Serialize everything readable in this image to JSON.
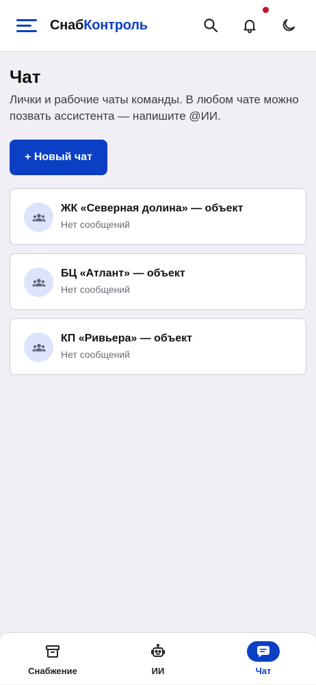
{
  "header": {
    "brand_part1": "Снаб",
    "brand_part2": "Контроль",
    "has_notification": true,
    "accent_color": "#0b3fc4",
    "notification_color": "#c8102e",
    "icons": [
      "menu-icon",
      "search-icon",
      "bell-icon",
      "moon-icon"
    ]
  },
  "page": {
    "title": "Чат",
    "subtitle": "Лички и рабочие чаты команды. В любом чате можно позвать ассистента — напишите @ИИ.",
    "new_chat_label": "+ Новый чат"
  },
  "chats": [
    {
      "title": "ЖК «Северная долина» — объект",
      "preview": "Нет сообщений",
      "icon": "group-icon"
    },
    {
      "title": "БЦ «Атлант» — объект",
      "preview": "Нет сообщений",
      "icon": "group-icon"
    },
    {
      "title": "КП «Ривьера» — объект",
      "preview": "Нет сообщений",
      "icon": "group-icon"
    }
  ],
  "bottom_nav": {
    "items": [
      {
        "label": "Снабжение",
        "icon": "archive-box-icon",
        "active": false
      },
      {
        "label": "ИИ",
        "icon": "robot-icon",
        "active": false
      },
      {
        "label": "Чат",
        "icon": "chat-bubble-icon",
        "active": true
      }
    ]
  }
}
